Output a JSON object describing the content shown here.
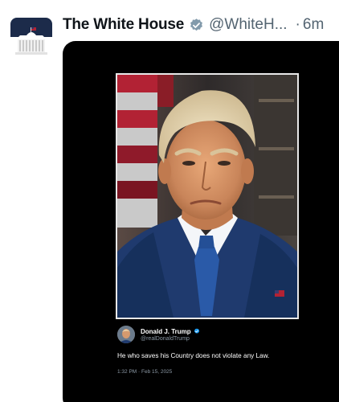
{
  "post": {
    "author_name": "The White House",
    "author_handle": "@WhiteH...",
    "separator": "·",
    "time": "6m",
    "verified_badge_color": "#829aab",
    "avatar_icon": "white-house-logo"
  },
  "embedded_post": {
    "author_name": "Donald J. Trump",
    "author_handle": "@realDonaldTrump",
    "text": "He who saves his Country does not violate any Law.",
    "timestamp": "1:32 PM · Feb 15, 2025",
    "verified_badge_color": "#1d9bf0"
  },
  "colors": {
    "media_background": "#000000",
    "secondary_text": "#536471"
  }
}
